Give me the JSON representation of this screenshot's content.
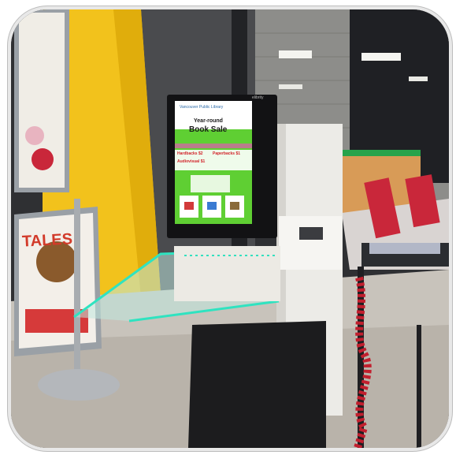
{
  "photo": {
    "kiosk_brand": "elibrity",
    "screen": {
      "library_name": "Vancouver Public Library",
      "heading_line1": "Year-round",
      "heading_line2": "Book Sale",
      "price_hardcover": "Hardbacks $2",
      "price_paperback": "Paperbacks $1",
      "price_audiovisual": "Audiovisual $1"
    },
    "poster": {
      "title": "TALES"
    }
  }
}
